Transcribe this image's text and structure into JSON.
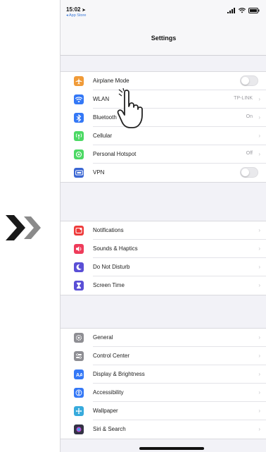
{
  "status": {
    "time": "15:02",
    "back_app": "◂ App Store"
  },
  "nav": {
    "title": "Settings"
  },
  "groups": [
    {
      "items": [
        {
          "label": "Airplane Mode",
          "icon": "airplane-icon",
          "color": "#f09a37",
          "toggle": true,
          "toggle_on": false
        },
        {
          "label": "WLAN",
          "icon": "wifi-icon",
          "color": "#3478f6",
          "value": "TP-LINK"
        },
        {
          "label": "Bluetooth",
          "icon": "bluetooth-icon",
          "color": "#3478f6",
          "value": "On"
        },
        {
          "label": "Cellular",
          "icon": "cellular-icon",
          "color": "#4cd964"
        },
        {
          "label": "Personal Hotspot",
          "icon": "hotspot-icon",
          "color": "#4cd964",
          "value": "Off"
        },
        {
          "label": "VPN",
          "icon": "vpn-icon",
          "color": "#3b67d3",
          "toggle": true,
          "toggle_on": false
        }
      ]
    },
    {
      "items": [
        {
          "label": "Notifications",
          "icon": "notifications-icon",
          "color": "#ee3b3b"
        },
        {
          "label": "Sounds & Haptics",
          "icon": "sounds-icon",
          "color": "#ee3b5a"
        },
        {
          "label": "Do Not Disturb",
          "icon": "moon-icon",
          "color": "#5a4fd6"
        },
        {
          "label": "Screen Time",
          "icon": "hourglass-icon",
          "color": "#5a4fd6"
        }
      ]
    },
    {
      "items": [
        {
          "label": "General",
          "icon": "gear-icon",
          "color": "#8e8e93"
        },
        {
          "label": "Control Center",
          "icon": "control-center-icon",
          "color": "#8e8e93"
        },
        {
          "label": "Display & Brightness",
          "icon": "display-icon",
          "color": "#3478f6"
        },
        {
          "label": "Accessibility",
          "icon": "accessibility-icon",
          "color": "#3478f6"
        },
        {
          "label": "Wallpaper",
          "icon": "wallpaper-icon",
          "color": "#37aadc"
        },
        {
          "label": "Siri & Search",
          "icon": "siri-icon",
          "color": "#333344"
        }
      ]
    }
  ],
  "colors": {
    "accent": "#3478f6",
    "chevron_arrows": "#111111",
    "chevron_arrows_light": "#8a8a8a"
  }
}
